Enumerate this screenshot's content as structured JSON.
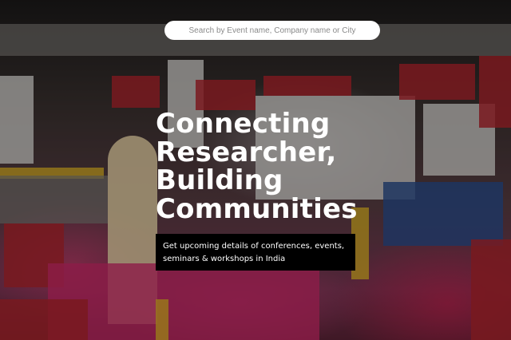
{
  "search": {
    "placeholder": "Search by Event name, Company name or City"
  },
  "hero": {
    "headline_lines": [
      "Connecting",
      "Researcher,",
      "Building",
      "Communities"
    ],
    "subtitle": "Get upcoming details of conferences, events, seminars & workshops in India"
  },
  "background": {
    "description_colors": {
      "floor": "#d02a6a",
      "booth_red": "#b3262e",
      "booth_blue": "#2d4f8e",
      "booth_white": "#d8d6d2"
    }
  }
}
